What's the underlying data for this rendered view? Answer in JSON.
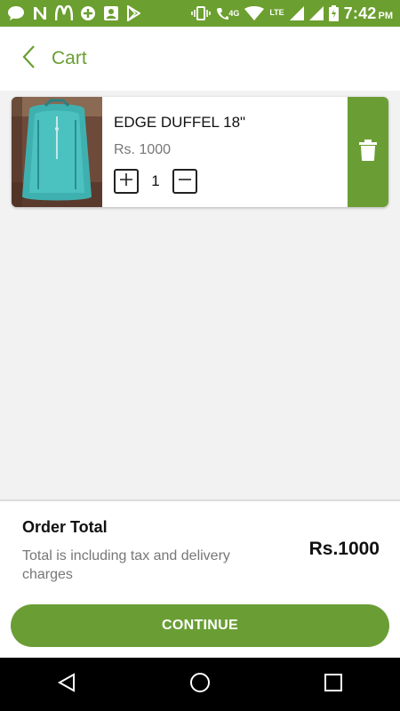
{
  "status_bar": {
    "time": "7:42",
    "ampm": "PM",
    "network_4g": "4G",
    "network_lte": "LTE",
    "color": "#6b9f2f",
    "icons": [
      "message-icon",
      "n-app-icon",
      "mcdonalds-icon",
      "plus-badge-icon",
      "contact-icon",
      "play-store-icon",
      "vibrate-icon",
      "call-4g-icon",
      "wifi-icon",
      "signal-icon",
      "battery-icon"
    ]
  },
  "app_bar": {
    "title": "Cart",
    "back_icon": "chevron-left-icon",
    "accent_color": "#6a9e32"
  },
  "cart": {
    "items": [
      {
        "name": "EDGE DUFFEL 18\"",
        "price": "Rs. 1000",
        "quantity": "1",
        "image": "teal-duffel-bag"
      }
    ]
  },
  "order_summary": {
    "title": "Order Total",
    "note": "Total is including tax and delivery charges",
    "amount": "Rs.1000"
  },
  "actions": {
    "continue_label": "CONTINUE"
  },
  "nav_bar": {
    "icons": [
      "back-triangle-icon",
      "home-circle-icon",
      "recents-square-icon"
    ]
  }
}
